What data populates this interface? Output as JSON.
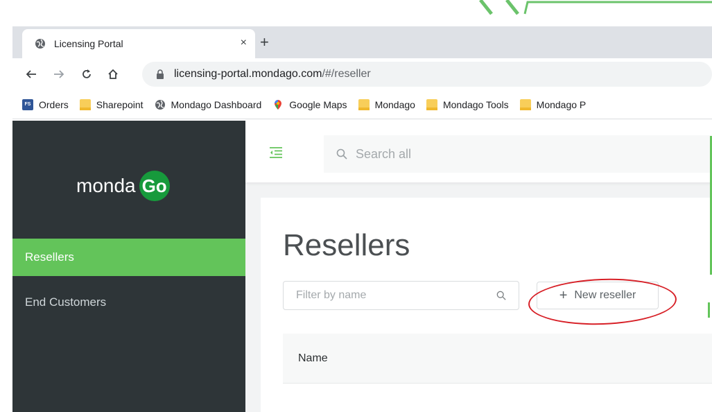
{
  "colors": {
    "sidebar_bg": "#2e3538",
    "active_item_bg": "#63c45a",
    "brand_green": "#179a3c",
    "callout_red": "#d71f26",
    "accent_green": "#6bc36b"
  },
  "browser": {
    "tab": {
      "title": "Licensing Portal",
      "close_glyph": "×",
      "favicon": "globe-icon"
    },
    "new_tab_glyph": "+",
    "nav": {
      "back": "←",
      "forward": "→",
      "reload": "C",
      "home": "⌂"
    },
    "url": {
      "host": "licensing-portal.mondago.com",
      "path": "/#/reseller"
    },
    "bookmarks": [
      {
        "label": "Orders",
        "icon": "fs-icon"
      },
      {
        "label": "Sharepoint",
        "icon": "folder-icon"
      },
      {
        "label": "Mondago Dashboard",
        "icon": "globe-icon"
      },
      {
        "label": "Google Maps",
        "icon": "map-pin-icon"
      },
      {
        "label": "Mondago",
        "icon": "folder-icon"
      },
      {
        "label": "Mondago Tools",
        "icon": "folder-icon"
      },
      {
        "label": "Mondago P",
        "icon": "folder-icon"
      }
    ],
    "fs_badge_text": "FS"
  },
  "sidebar": {
    "logo_text": "monda",
    "logo_badge": "Go",
    "items": [
      {
        "label": "Resellers",
        "active": true
      },
      {
        "label": "End Customers",
        "active": false
      }
    ]
  },
  "topbar": {
    "search_placeholder": "Search all"
  },
  "page": {
    "title": "Resellers",
    "filter_placeholder": "Filter by name",
    "new_button_plus": "+",
    "new_button_label": "New reseller",
    "table_columns": [
      "Name"
    ]
  }
}
